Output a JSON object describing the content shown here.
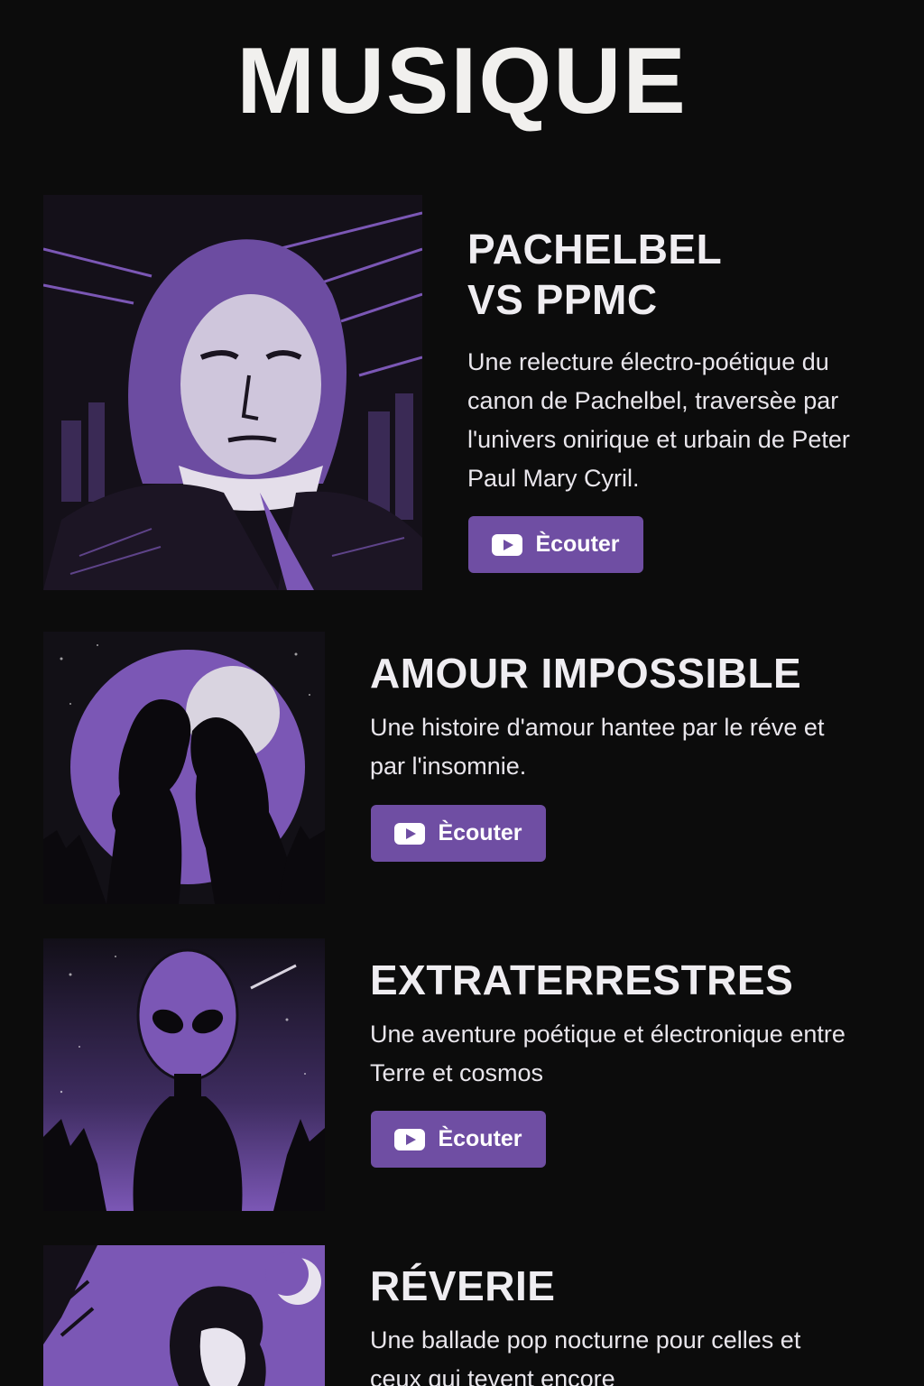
{
  "page": {
    "title": "MUSIQUE"
  },
  "colors": {
    "background": "#0c0c0c",
    "accent": "#6f4ea3",
    "art_purple": "#7b57b5",
    "text": "#f2f0f4"
  },
  "tracks": [
    {
      "title": "PACHELBEL\nVS PPMC",
      "description": "Une relecture électro-poétique du canon de Pachelbel, traversèe par l'univers onirique et urbain de Peter Paul Mary Cyril.",
      "button_label": "Ècouter",
      "button_icon": "youtube-play-icon",
      "art": "portrait-illustration"
    },
    {
      "title": "AMOUR IMPOSSIBLE",
      "description": "Une histoire d'amour hantee par le réve et par l'insomnie.",
      "button_label": "Ècouter",
      "button_icon": "youtube-play-icon",
      "art": "couple-moon-illustration"
    },
    {
      "title": "EXTRATERRESTRES",
      "description": "Une aventure poétique et électronique entre Terre et cosmos",
      "button_label": "Ècouter",
      "button_icon": "youtube-play-icon",
      "art": "alien-illustration"
    },
    {
      "title": "RÉVERIE",
      "description": "Une ballade pop nocturne pour celles et ceux qui tevent encore",
      "art": "dreamer-moon-illustration"
    }
  ]
}
